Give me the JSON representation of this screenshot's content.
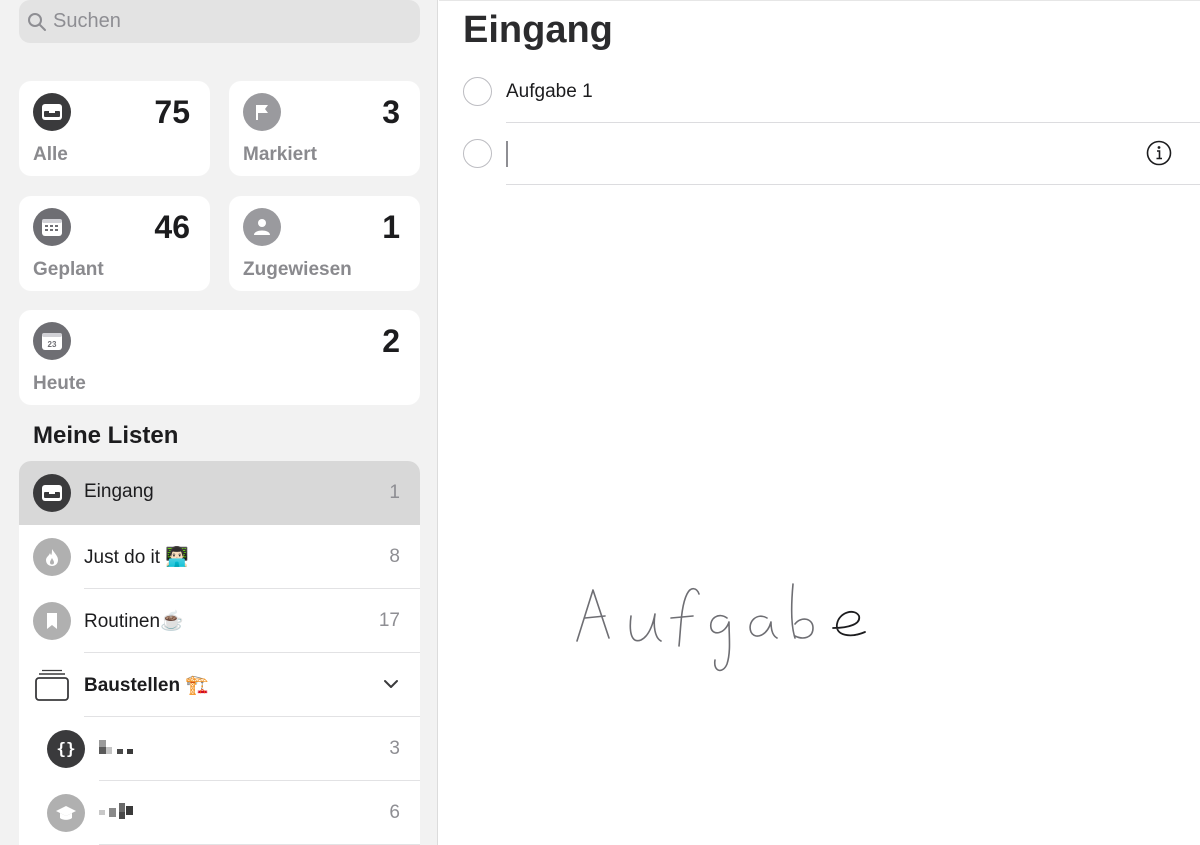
{
  "search": {
    "placeholder": "Suchen"
  },
  "smart_lists": {
    "all": {
      "label": "Alle",
      "count": "75"
    },
    "flagged": {
      "label": "Markiert",
      "count": "3"
    },
    "scheduled": {
      "label": "Geplant",
      "count": "46"
    },
    "assigned": {
      "label": "Zugewiesen",
      "count": "1"
    },
    "today": {
      "label": "Heute",
      "count": "2",
      "icon_day": "23"
    }
  },
  "my_lists": {
    "title": "Meine Listen",
    "items": [
      {
        "name": "Eingang",
        "count": "1",
        "icon": "inbox-icon",
        "selected": true
      },
      {
        "name": "Just do it 👨🏻‍💻",
        "count": "8",
        "icon": "flame-icon"
      },
      {
        "name": "Routinen☕️",
        "count": "17",
        "icon": "bookmark-icon"
      },
      {
        "name": "Baustellen 🏗️",
        "icon": "stack-icon",
        "group": true
      },
      {
        "name": "",
        "count": "3",
        "icon": "braces-icon",
        "redacted": true
      },
      {
        "name": "",
        "count": "6",
        "icon": "graduation-cap-icon",
        "redacted": true
      }
    ]
  },
  "main": {
    "title": "Eingang",
    "tasks": [
      {
        "text": "Aufgabe 1"
      }
    ],
    "handwriting_text": "Aufgabe"
  },
  "colors": {
    "sidebar_bg": "#f2f2f2",
    "card_bg": "#ffffff",
    "selected_row": "#d8d8d8",
    "icon_dark": "#3a3a3c",
    "icon_gray": "#8e8e93",
    "icon_light": "#b0b0b0"
  }
}
